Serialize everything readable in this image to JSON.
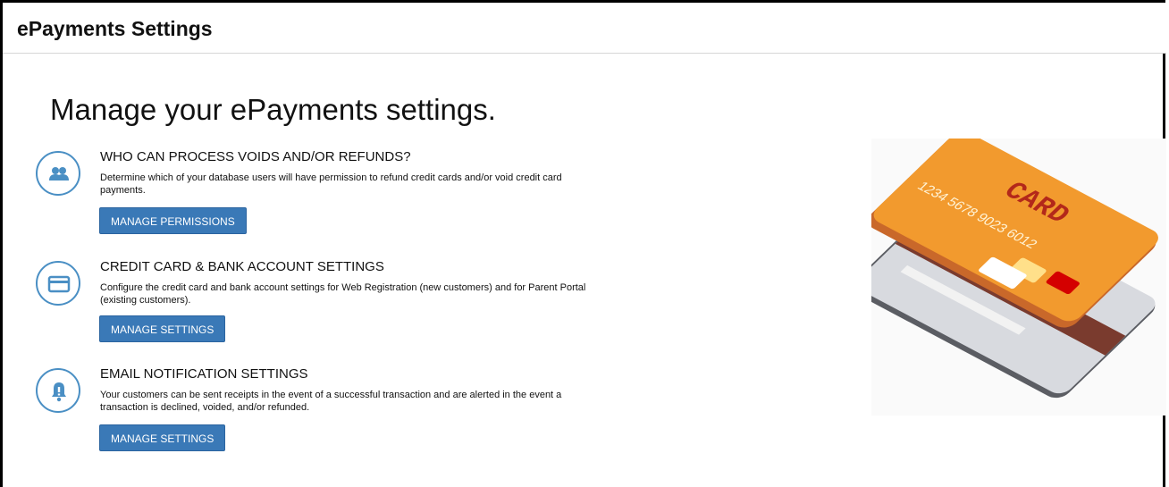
{
  "header": {
    "title": "ePayments Settings"
  },
  "page": {
    "heading": "Manage your ePayments settings."
  },
  "sections": [
    {
      "icon": "users-icon",
      "title": "WHO CAN PROCESS VOIDS AND/OR REFUNDS?",
      "description": "Determine which of your database users will have permission to refund credit cards and/or void credit card payments.",
      "button_label": "MANAGE PERMISSIONS"
    },
    {
      "icon": "credit-card-icon",
      "title": "CREDIT CARD & BANK ACCOUNT SETTINGS",
      "description": "Configure the credit card and bank account settings for Web Registration (new customers) and for Parent Portal (existing customers).",
      "button_label": "MANAGE SETTINGS"
    },
    {
      "icon": "bell-icon",
      "title": "EMAIL NOTIFICATION SETTINGS",
      "description": "Your customers can be sent receipts in the event of a successful transaction and are alerted in the event a transaction is declined, voided, and/or refunded.",
      "button_label": "MANAGE SETTINGS"
    }
  ],
  "illustration": {
    "card_label": "CARD",
    "card_number": "1234 5678 9023 6012"
  },
  "colors": {
    "accent": "#3a79b7",
    "icon_ring": "#4a8fc4",
    "card_orange": "#f29a2e",
    "card_stripe": "#7a3b2e"
  }
}
